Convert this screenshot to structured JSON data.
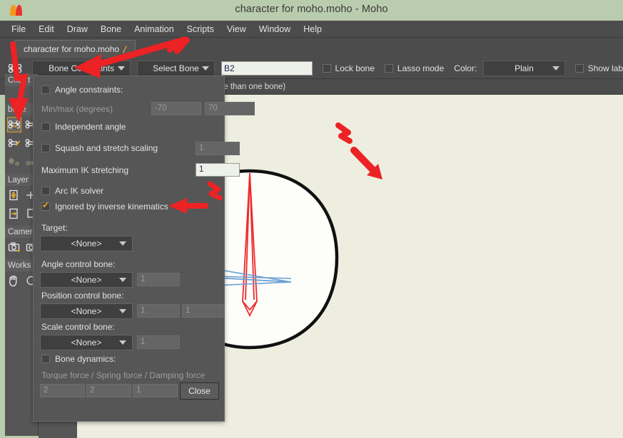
{
  "window": {
    "title": "character for moho.moho - Moho",
    "logo_icon": "moho-logo-icon"
  },
  "menubar": {
    "items": [
      "File",
      "Edit",
      "Draw",
      "Bone",
      "Animation",
      "Scripts",
      "View",
      "Window",
      "Help"
    ]
  },
  "tabstrip": {
    "tab_label": "character for moho.moho",
    "tab_modified_icon": "pencil-icon"
  },
  "optionsbar": {
    "tool_icon": "bone-select-icon",
    "mode_combo": "Bone Constraints",
    "bone_combo": "Select Bone",
    "bone_name_value": "B2",
    "lock_bone_label": "Lock bone",
    "lock_bone_checked": false,
    "lasso_mode_label": "Lasso mode",
    "lasso_mode_checked": false,
    "color_label": "Color:",
    "color_combo": "Plain",
    "show_labels_label": "Show lab",
    "show_labels_checked": false
  },
  "statusbar": {
    "left_text": "Click t",
    "right_text": "ct more than one bone)"
  },
  "sidebar": {
    "groups": [
      {
        "header": "Click t",
        "rows": []
      },
      {
        "header": "bone",
        "rows": [
          [
            {
              "icon": "bone-select-icon",
              "active": true
            },
            {
              "icon": "bone-add-icon",
              "active": false
            }
          ],
          [
            {
              "icon": "bone-translate-icon",
              "active": false
            },
            {
              "icon": "bone-bind-icon",
              "active": false
            }
          ],
          [
            {
              "icon": "bone-flexi-icon",
              "active": false
            },
            {
              "icon": "bone-offset-icon",
              "active": false
            }
          ]
        ]
      },
      {
        "header": "Layer",
        "rows": [
          [
            {
              "icon": "layer-translate-icon",
              "active": false
            },
            {
              "icon": "layer-scale-icon",
              "active": false
            }
          ],
          [
            {
              "icon": "layer-rotate-icon",
              "active": false
            },
            {
              "icon": "layer-shear-icon",
              "active": false
            }
          ]
        ]
      },
      {
        "header": "Camer",
        "rows": [
          [
            {
              "icon": "camera-track-icon",
              "active": false
            },
            {
              "icon": "camera-zoom-icon",
              "active": false
            }
          ]
        ]
      },
      {
        "header": "Works",
        "rows": [
          [
            {
              "icon": "pan-hand-icon",
              "active": false
            },
            {
              "icon": "orbit-icon",
              "active": false
            }
          ]
        ]
      }
    ]
  },
  "dialog": {
    "title": "Bone Constraints",
    "angle_constraints_label": "Angle constraints:",
    "angle_constraints_checked": false,
    "minmax_label": "Min/max (degrees)",
    "min_value": "-70",
    "max_value": "70",
    "independent_angle_label": "Independent angle",
    "independent_angle_checked": false,
    "squash_stretch_label": "Squash and stretch scaling",
    "squash_stretch_checked": false,
    "squash_stretch_value": "1",
    "max_ik_stretching_label": "Maximum IK stretching",
    "max_ik_stretching_value": "1",
    "arc_ik_label": "Arc IK solver",
    "arc_ik_checked": false,
    "ignored_ik_label": "Ignored by inverse kinematics",
    "ignored_ik_checked": true,
    "target_label": "Target:",
    "target_value": "<None>",
    "angle_control_label": "Angle control bone:",
    "angle_control_value": "<None>",
    "angle_control_scalar": "1",
    "position_control_label": "Position control bone:",
    "position_control_value": "<None>",
    "position_control_x": "1",
    "position_control_y": "1",
    "scale_control_label": "Scale control bone:",
    "scale_control_value": "<None>",
    "scale_control_scalar": "1",
    "bone_dynamics_label": "Bone dynamics:",
    "bone_dynamics_checked": false,
    "forces_label": "Torque force / Spring force / Damping force",
    "torque_value": "2",
    "spring_value": "2",
    "damping_value": "1",
    "close_label": "Close"
  },
  "colors": {
    "title_bg": "#b9ccad",
    "chrome": "#4c4c4c",
    "panel": "#565656",
    "canvas_bg": "#eeeee0",
    "accent_orange": "#e09a1c",
    "annotation_red": "#ec2224",
    "bone_cyan": "#25d5d5",
    "bone_blue": "#6a9fd4",
    "bone_red": "#ee2b2b",
    "bone_gold": "#e8c84a"
  },
  "canvas": {
    "shapes": [
      {
        "name": "head-circle",
        "type": "outline-circle"
      },
      {
        "name": "neck-rectangle",
        "type": "outline-rect"
      },
      {
        "name": "bone-b2-cyan",
        "type": "bone"
      },
      {
        "name": "bone-head-red",
        "type": "bone"
      },
      {
        "name": "bone-jaw-blue",
        "type": "bone"
      },
      {
        "name": "origin-axes",
        "type": "crosshair"
      },
      {
        "name": "bone-root-gold",
        "type": "bone-fan"
      }
    ]
  },
  "annotations": [
    {
      "name": "arrow-to-sidebar-bone-tool",
      "color": "#ec2224"
    },
    {
      "name": "arrow-to-bone-constraints-combo",
      "color": "#ec2224"
    },
    {
      "name": "squiggle-near-select-bone",
      "color": "#ec2224"
    },
    {
      "name": "arrow-to-ignored-by-ik",
      "color": "#ec2224"
    },
    {
      "name": "squiggle-near-ignored-by-ik",
      "color": "#ec2224"
    },
    {
      "name": "arrow-to-head-bone",
      "color": "#ec2224"
    },
    {
      "name": "squiggle-above-head-bone",
      "color": "#ec2224"
    }
  ]
}
